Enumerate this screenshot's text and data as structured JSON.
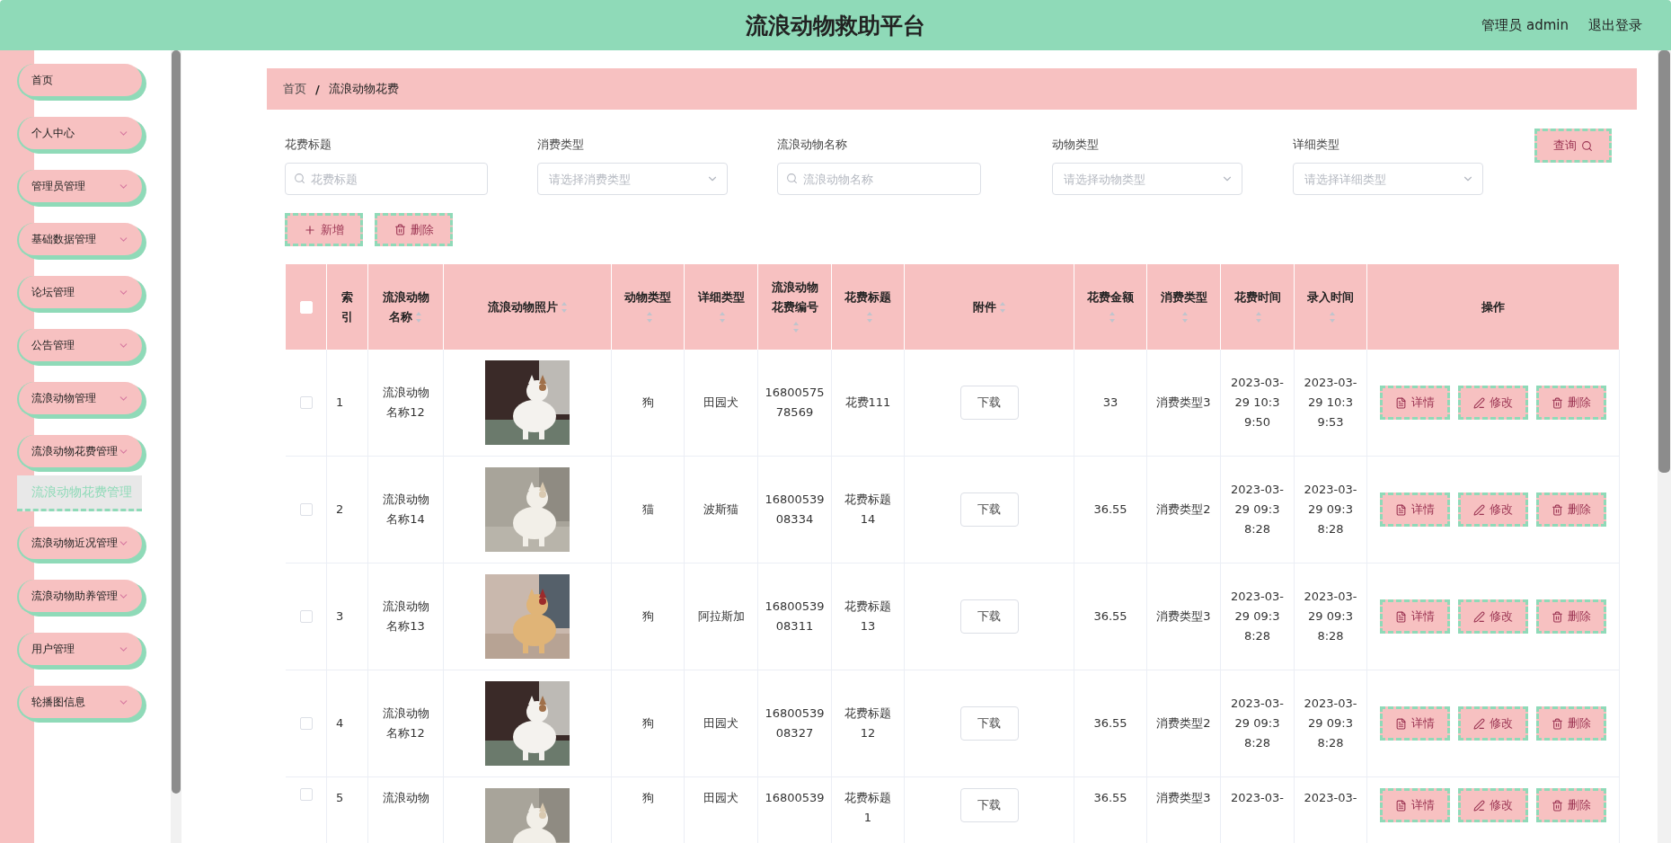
{
  "header": {
    "title": "流浪动物救助平台",
    "user": "管理员 admin",
    "logout": "退出登录"
  },
  "sidebar": {
    "items": [
      {
        "label": "首页",
        "kind": "link"
      },
      {
        "label": "个人中心",
        "kind": "submenu"
      },
      {
        "label": "管理员管理",
        "kind": "submenu"
      },
      {
        "label": "基础数据管理",
        "kind": "submenu"
      },
      {
        "label": "论坛管理",
        "kind": "submenu"
      },
      {
        "label": "公告管理",
        "kind": "submenu"
      },
      {
        "label": "流浪动物管理",
        "kind": "submenu"
      },
      {
        "label": "流浪动物花费管理",
        "kind": "submenu",
        "children": [
          {
            "label": "流浪动物花费管理",
            "selected": true
          }
        ]
      },
      {
        "label": "流浪动物近况管理",
        "kind": "submenu"
      },
      {
        "label": "流浪动物助养管理",
        "kind": "submenu"
      },
      {
        "label": "用户管理",
        "kind": "submenu"
      },
      {
        "label": "轮播图信息",
        "kind": "submenu"
      }
    ]
  },
  "breadcrumb": {
    "items": [
      "首页",
      "流浪动物花费"
    ],
    "separator": "/"
  },
  "filters": [
    {
      "label": "花费标题",
      "kind": "text",
      "placeholder": "花费标题"
    },
    {
      "label": "消费类型",
      "kind": "select",
      "placeholder": "请选择消费类型"
    },
    {
      "label": "流浪动物名称",
      "kind": "text",
      "placeholder": "流浪动物名称"
    },
    {
      "label": "动物类型",
      "kind": "select",
      "placeholder": "请选择动物类型"
    },
    {
      "label": "详细类型",
      "kind": "select",
      "placeholder": "请选择详细类型"
    }
  ],
  "query_button": "查询",
  "actions": [
    {
      "label": "新增",
      "kind": "add"
    },
    {
      "label": "删除",
      "kind": "delete"
    }
  ],
  "table": {
    "columns": [
      {
        "kind": "checkbox",
        "checked": false
      },
      {
        "kind": "text",
        "label": "索引",
        "sortable": false
      },
      {
        "kind": "text",
        "label": "流浪动物名称",
        "sortable": true
      },
      {
        "kind": "text",
        "label": "流浪动物照片",
        "sortable": true
      },
      {
        "kind": "text",
        "label": "动物类型",
        "sortable": true
      },
      {
        "kind": "text",
        "label": "详细类型",
        "sortable": true
      },
      {
        "kind": "text",
        "label": "流浪动物花费编号",
        "sortable": true
      },
      {
        "kind": "text",
        "label": "花费标题",
        "sortable": true
      },
      {
        "kind": "text",
        "label": "附件",
        "sortable": true
      },
      {
        "kind": "text",
        "label": "花费金额",
        "sortable": true
      },
      {
        "kind": "text",
        "label": "消费类型",
        "sortable": true
      },
      {
        "kind": "text",
        "label": "花费时间",
        "sortable": true
      },
      {
        "kind": "text",
        "label": "录入时间",
        "sortable": true
      },
      {
        "kind": "text",
        "label": "操作",
        "sortable": false
      }
    ],
    "rows": [
      {
        "checked": false,
        "index": "1",
        "name": "流浪动物名称12",
        "animal_type": "狗",
        "detail_type": "田园犬",
        "number": "1680057578569",
        "title": "花费111",
        "attachment": "下载",
        "amount": "33",
        "consumption_type": "消费类型3",
        "spend_time": "2023-03-29 10:39:50",
        "created_time": "2023-03-29 10:39:53",
        "operations": [
          "详情",
          "修改",
          "删除"
        ]
      },
      {
        "checked": false,
        "index": "2",
        "name": "流浪动物名称14",
        "animal_type": "猫",
        "detail_type": "波斯猫",
        "number": "1680053908334",
        "title": "花费标题14",
        "attachment": "下载",
        "amount": "36.55",
        "consumption_type": "消费类型2",
        "spend_time": "2023-03-29 09:38:28",
        "created_time": "2023-03-29 09:38:28",
        "operations": [
          "详情",
          "修改",
          "删除"
        ]
      },
      {
        "checked": false,
        "index": "3",
        "name": "流浪动物名称13",
        "animal_type": "狗",
        "detail_type": "阿拉斯加",
        "number": "1680053908311",
        "title": "花费标题13",
        "attachment": "下载",
        "amount": "36.55",
        "consumption_type": "消费类型3",
        "spend_time": "2023-03-29 09:38:28",
        "created_time": "2023-03-29 09:38:28",
        "operations": [
          "详情",
          "修改",
          "删除"
        ]
      },
      {
        "checked": false,
        "index": "4",
        "name": "流浪动物名称12",
        "animal_type": "狗",
        "detail_type": "田园犬",
        "number": "1680053908327",
        "title": "花费标题12",
        "attachment": "下载",
        "amount": "36.55",
        "consumption_type": "消费类型2",
        "spend_time": "2023-03-29 09:38:28",
        "created_time": "2023-03-29 09:38:28",
        "operations": [
          "详情",
          "修改",
          "删除"
        ]
      },
      {
        "checked": false,
        "index": "5",
        "name": "流浪动物",
        "animal_type": "狗",
        "detail_type": "田园犬",
        "number": "16800539",
        "title": "花费标题1",
        "attachment": "下载",
        "amount": "36.55",
        "consumption_type": "消费类型3",
        "spend_time": "2023-03-",
        "created_time": "2023-03-",
        "operations": [
          "详情",
          "修改",
          "删除"
        ]
      }
    ]
  }
}
